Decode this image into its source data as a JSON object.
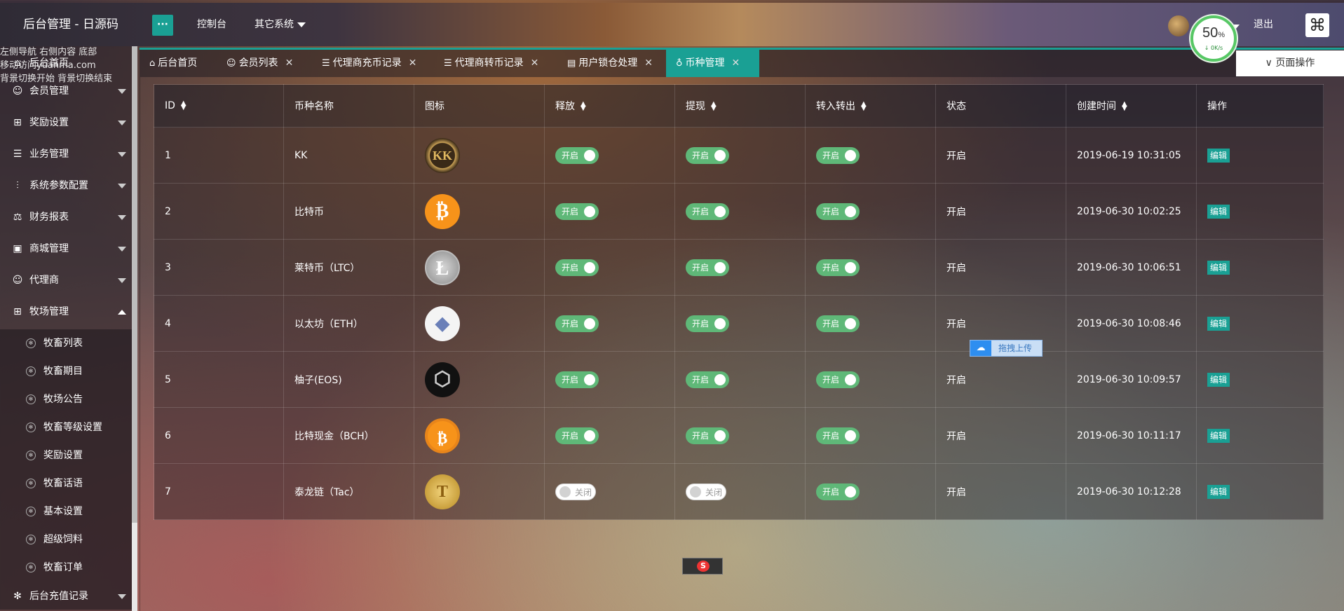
{
  "header": {
    "brand": "后台管理 - 日源码",
    "menu_toggle": "···",
    "links": [
      {
        "label": "控制台"
      },
      {
        "label": "其它系统"
      }
    ],
    "speed": {
      "percent": "50",
      "unit": "%",
      "rate": "↓ 0K/s"
    },
    "logout": "退出"
  },
  "overlay_lines": [
    "左侧导航 右侧内容 底部",
    "移动访问yuanma.com",
    "背景切换开始 背景切换结束"
  ],
  "sidebar": {
    "items": [
      {
        "label": "后台首页",
        "icon": "home-icon"
      },
      {
        "label": "会员管理",
        "icon": "user-icon"
      },
      {
        "label": "奖励设置",
        "icon": "gift-icon"
      },
      {
        "label": "业务管理",
        "icon": "list-icon"
      },
      {
        "label": "系统参数配置",
        "icon": "sliders-icon"
      },
      {
        "label": "财务报表",
        "icon": "chart-icon"
      },
      {
        "label": "商城管理",
        "icon": "shop-icon"
      },
      {
        "label": "代理商",
        "icon": "agent-icon"
      },
      {
        "label": "牧场管理",
        "icon": "gift-icon"
      }
    ],
    "sub_items": [
      {
        "label": "牧畜列表"
      },
      {
        "label": "牧畜期目"
      },
      {
        "label": "牧场公告"
      },
      {
        "label": "牧畜等级设置"
      },
      {
        "label": "奖励设置"
      },
      {
        "label": "牧畜话语"
      },
      {
        "label": "基本设置"
      },
      {
        "label": "超级饲料"
      },
      {
        "label": "牧畜订单"
      }
    ],
    "bottom_item": {
      "label": "后台充值记录"
    }
  },
  "tabs": [
    {
      "label": "后台首页",
      "closable": false
    },
    {
      "label": "会员列表",
      "closable": true
    },
    {
      "label": "代理商充币记录",
      "closable": true
    },
    {
      "label": "代理商转币记录",
      "closable": true
    },
    {
      "label": "用户锁仓处理",
      "closable": true
    },
    {
      "label": "币种管理",
      "closable": true,
      "active": true
    }
  ],
  "page_ops": "页面操作",
  "table": {
    "columns": [
      "ID",
      "币种名称",
      "图标",
      "释放",
      "提现",
      "转入转出",
      "状态",
      "创建时间",
      "操作"
    ],
    "switch_on_label": "开启",
    "switch_off_label": "关闭",
    "edit_label": "编辑",
    "rows": [
      {
        "id": "1",
        "name": "KK",
        "icon_text": "KK",
        "release": "开启",
        "withdraw": "开启",
        "transfer": "开启",
        "status": "开启",
        "created": "2019-06-19 10:31:05"
      },
      {
        "id": "2",
        "name": "比特币",
        "icon_text": "₿",
        "release": "开启",
        "withdraw": "开启",
        "transfer": "开启",
        "status": "开启",
        "created": "2019-06-30 10:02:25"
      },
      {
        "id": "3",
        "name": "莱特币（LTC）",
        "icon_text": "Ł",
        "release": "开启",
        "withdraw": "开启",
        "transfer": "开启",
        "status": "开启",
        "created": "2019-06-30 10:06:51"
      },
      {
        "id": "4",
        "name": "以太坊（ETH）",
        "icon_text": "◆",
        "release": "开启",
        "withdraw": "开启",
        "transfer": "开启",
        "status": "开启",
        "created": "2019-06-30 10:08:46"
      },
      {
        "id": "5",
        "name": "柚子(EOS)",
        "icon_text": "⬡",
        "release": "开启",
        "withdraw": "开启",
        "transfer": "开启",
        "status": "开启",
        "created": "2019-06-30 10:09:57"
      },
      {
        "id": "6",
        "name": "比特现金（BCH）",
        "icon_text": "₿",
        "release": "开启",
        "withdraw": "开启",
        "transfer": "开启",
        "status": "开启",
        "created": "2019-06-30 10:11:17"
      },
      {
        "id": "7",
        "name": "泰龙链（Tac）",
        "icon_text": "T",
        "release": "关闭",
        "withdraw": "关闭",
        "transfer": "开启",
        "status": "开启",
        "created": "2019-06-30 10:12:28"
      }
    ]
  },
  "upload_widget": "拖拽上传",
  "colors": {
    "accent": "#1aa094",
    "switch_on": "#5fb878"
  }
}
